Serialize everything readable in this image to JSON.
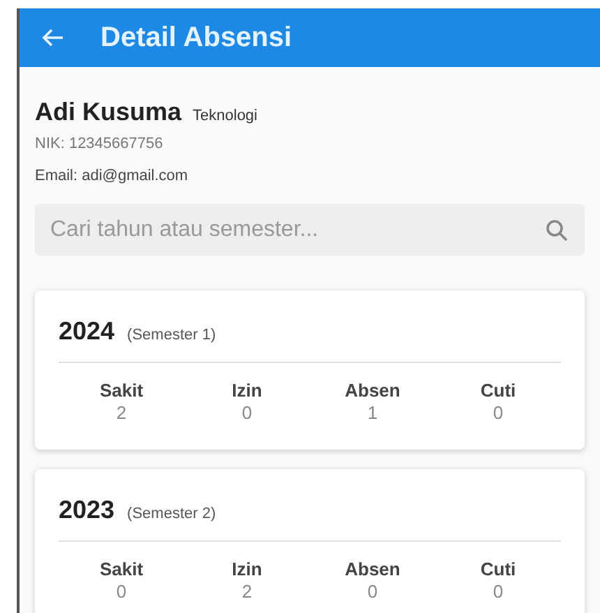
{
  "app_bar": {
    "title": "Detail Absensi"
  },
  "profile": {
    "name": "Adi Kusuma",
    "department": "Teknologi",
    "nik": "NIK: 12345667756",
    "email": "Email: adi@gmail.com"
  },
  "search": {
    "placeholder": "Cari tahun atau semester..."
  },
  "records": [
    {
      "year": "2024",
      "semester": "(Semester 1)",
      "stats": [
        {
          "label": "Sakit",
          "value": "2"
        },
        {
          "label": "Izin",
          "value": "0"
        },
        {
          "label": "Absen",
          "value": "1"
        },
        {
          "label": "Cuti",
          "value": "0"
        }
      ]
    },
    {
      "year": "2023",
      "semester": "(Semester 2)",
      "stats": [
        {
          "label": "Sakit",
          "value": "0"
        },
        {
          "label": "Izin",
          "value": "2"
        },
        {
          "label": "Absen",
          "value": "0"
        },
        {
          "label": "Cuti",
          "value": "0"
        }
      ]
    }
  ]
}
